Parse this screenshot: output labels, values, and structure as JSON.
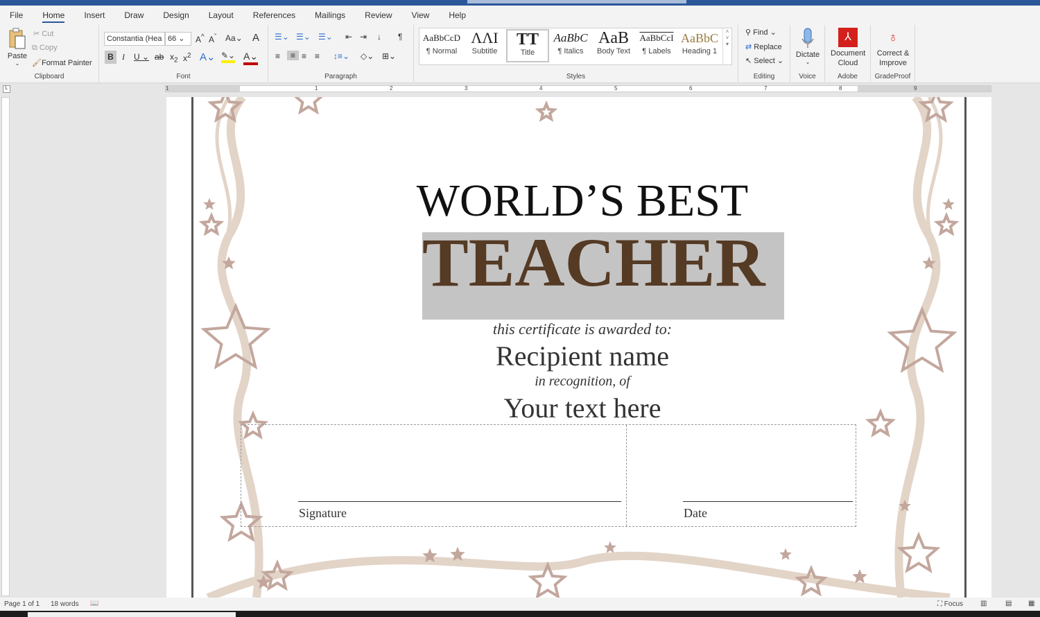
{
  "menu_tabs": [
    "File",
    "Home",
    "Insert",
    "Draw",
    "Design",
    "Layout",
    "References",
    "Mailings",
    "Review",
    "View",
    "Help"
  ],
  "active_tab": "Home",
  "clipboard": {
    "paste": "Paste",
    "cut": "Cut",
    "copy": "Copy",
    "format_painter": "Format Painter",
    "label": "Clipboard"
  },
  "font": {
    "name": "Constantia (Hea",
    "size": "66",
    "label": "Font",
    "change_case": "Aa"
  },
  "paragraph": {
    "label": "Paragraph"
  },
  "styles": {
    "label": "Styles",
    "items": [
      {
        "preview": "AaBbCcD",
        "name": "¶ Normal"
      },
      {
        "preview": "ΛΛΙ",
        "name": "Subtitle"
      },
      {
        "preview": "ΤΤ",
        "name": "Title"
      },
      {
        "preview": "AaBbC",
        "name": "¶ Italics"
      },
      {
        "preview": "AaB",
        "name": "Body Text"
      },
      {
        "preview": "AaBbCcI",
        "name": "¶ Labels"
      },
      {
        "preview": "AaBbC",
        "name": "Heading 1"
      }
    ],
    "active": "Title"
  },
  "editing": {
    "find": "Find",
    "replace": "Replace",
    "select": "Select",
    "label": "Editing"
  },
  "voice": {
    "dictate": "Dictate",
    "label": "Voice"
  },
  "adobe": {
    "button": "Document Cloud",
    "label": "Adobe"
  },
  "gradeproof": {
    "button": "Correct & Improve",
    "label": "GradeProof"
  },
  "ruler_numbers": [
    "1",
    "1",
    "2",
    "3",
    "4",
    "5",
    "6",
    "7",
    "8",
    "9"
  ],
  "certificate": {
    "line1": "WORLD’S BEST",
    "line2": "TEACHER",
    "awarded": "this certificate is awarded to:",
    "recipient": "Recipient name",
    "recognition": "in recognition, of",
    "text": "Your text here",
    "signature": "Signature",
    "date": "Date"
  },
  "colors": {
    "accent": "#2b579a",
    "teacher": "#553a24",
    "highlight": "#c4c4c4",
    "stars": "#c3a79d",
    "swirls": "#e3d4c8"
  },
  "status": {
    "page": "Page 1 of 1",
    "words": "18 words",
    "focus": "Focus"
  }
}
